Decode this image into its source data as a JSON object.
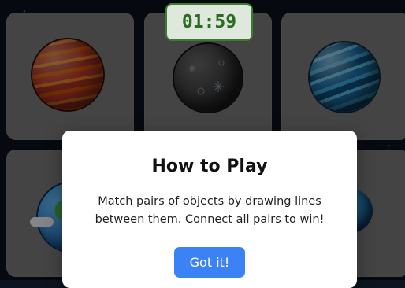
{
  "timer": {
    "value": "01:59"
  },
  "cards": [
    {
      "object": "red-striped-planet-icon"
    },
    {
      "object": "dark-cratered-planet-icon"
    },
    {
      "object": "blue-planet-icon"
    },
    {
      "object": "earth-planet-icon"
    },
    {
      "object": "hidden"
    },
    {
      "object": "blue-planet-icon"
    }
  ],
  "modal": {
    "title": "How to Play",
    "body": "Match pairs of objects by drawing lines between them. Connect all pairs to win!",
    "button_label": "Got it!"
  },
  "colors": {
    "timer_border": "#3a7d2c",
    "timer_text": "#2d6a22",
    "button": "#3b82f6"
  }
}
